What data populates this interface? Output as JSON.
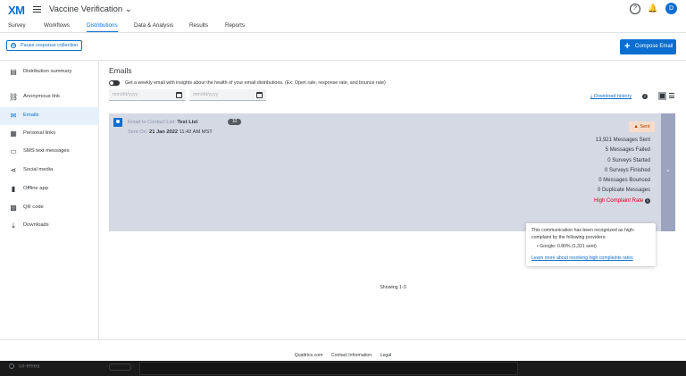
{
  "header": {
    "logo": "XM",
    "project_title": "Vaccine Verification",
    "chevron": "⌄",
    "help_icon": "?",
    "bell_icon": "🔔",
    "avatar_initial": "D"
  },
  "nav": {
    "tabs": [
      {
        "label": "Survey"
      },
      {
        "label": "Workflows"
      },
      {
        "label": "Distributions"
      },
      {
        "label": "Data & Analysis"
      },
      {
        "label": "Results"
      },
      {
        "label": "Reports"
      }
    ],
    "active_index": 2
  },
  "toolbar": {
    "pause_label": "Pause response collection",
    "compose_label": "Compose Email"
  },
  "sidebar": {
    "items": [
      {
        "label": "Distribution summary",
        "icon": "summary-icon"
      },
      {
        "label": "Anonymous link",
        "icon": "link-icon"
      },
      {
        "label": "Emails",
        "icon": "envelope-icon"
      },
      {
        "label": "Personal links",
        "icon": "personal-link-icon"
      },
      {
        "label": "SMS text messages",
        "icon": "sms-icon"
      },
      {
        "label": "Social media",
        "icon": "share-icon"
      },
      {
        "label": "Offline app",
        "icon": "tablet-icon"
      },
      {
        "label": "QR code",
        "icon": "qr-code-icon"
      },
      {
        "label": "Downloads",
        "icon": "download-icon"
      }
    ],
    "active_index": 2
  },
  "main": {
    "heading": "Emails",
    "toggle_text": "Get a weekly email with insights about the health of your email distributions. (Ex: Open rate, response rate, and bounce rate)",
    "date_placeholder_1": "mm/dd/yyyy",
    "date_placeholder_2": "mm/dd/yyyy",
    "download_history": "Download history",
    "showing": "Showing 1-3"
  },
  "card": {
    "line1_prefix": "Email to Contact List:",
    "list_name": "Test List",
    "count_badge": "10",
    "line2_prefix": "Sent On:",
    "sent_date": "21 Jan 2022",
    "sent_time": "11:42 AM MST",
    "status": "Sent",
    "stats": [
      {
        "text": "13,921 Messages Sent"
      },
      {
        "text": "5 Messages Failed"
      },
      {
        "text": "0 Surveys Started"
      },
      {
        "text": "0 Surveys Finished"
      },
      {
        "text": "0 Messages Bounced"
      },
      {
        "text": "0 Duplicate Messages"
      }
    ],
    "complaint_label": "High Complaint Rate"
  },
  "tooltip": {
    "text": "This communication has been recognized as high-complaint by the following providers:",
    "bullet": "Google: 0.80% (1,321 sent)",
    "link": "Learn more about resolving high complaints rates"
  },
  "footer": {
    "links": [
      {
        "label": "Qualtrics.com"
      },
      {
        "label": "Contact Information"
      },
      {
        "label": "Legal"
      }
    ]
  },
  "taskbar": {
    "label": "ux-emea"
  },
  "colors": {
    "accent": "#0b6ed0",
    "card_bg": "#d5d9e4",
    "card_side": "#9ba3bf",
    "danger": "#d90017",
    "sent_badge_bg": "#f6dcc9"
  }
}
